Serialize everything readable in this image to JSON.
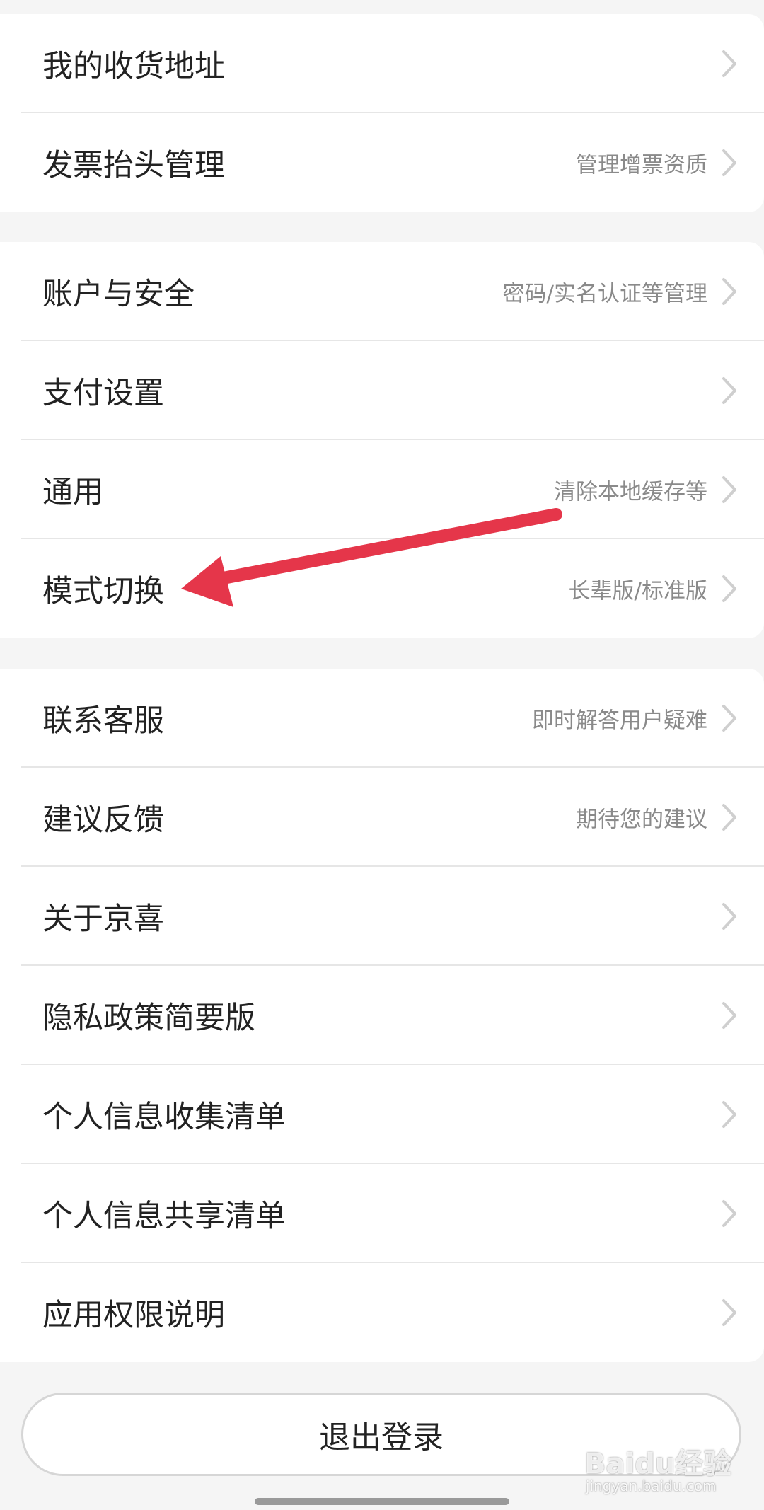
{
  "groups": [
    {
      "items": [
        {
          "title": "我的收货地址",
          "subtitle": ""
        },
        {
          "title": "发票抬头管理",
          "subtitle": "管理增票资质"
        }
      ]
    },
    {
      "items": [
        {
          "title": "账户与安全",
          "subtitle": "密码/实名认证等管理"
        },
        {
          "title": "支付设置",
          "subtitle": ""
        },
        {
          "title": "通用",
          "subtitle": "清除本地缓存等"
        },
        {
          "title": "模式切换",
          "subtitle": "长辈版/标准版"
        }
      ]
    },
    {
      "items": [
        {
          "title": "联系客服",
          "subtitle": "即时解答用户疑难"
        },
        {
          "title": "建议反馈",
          "subtitle": "期待您的建议"
        },
        {
          "title": "关于京喜",
          "subtitle": ""
        },
        {
          "title": "隐私政策简要版",
          "subtitle": ""
        },
        {
          "title": "个人信息收集清单",
          "subtitle": ""
        },
        {
          "title": "个人信息共享清单",
          "subtitle": ""
        },
        {
          "title": "应用权限说明",
          "subtitle": ""
        }
      ]
    }
  ],
  "logout_label": "退出登录",
  "watermark": {
    "text": "Baidu经验",
    "sub": "jingyan.baidu.com"
  },
  "colors": {
    "arrow": "#e5364a",
    "chevron": "#cfcfcf",
    "background": "#f5f5f5"
  },
  "icons": {
    "row_chevron": "chevron-right-icon"
  }
}
